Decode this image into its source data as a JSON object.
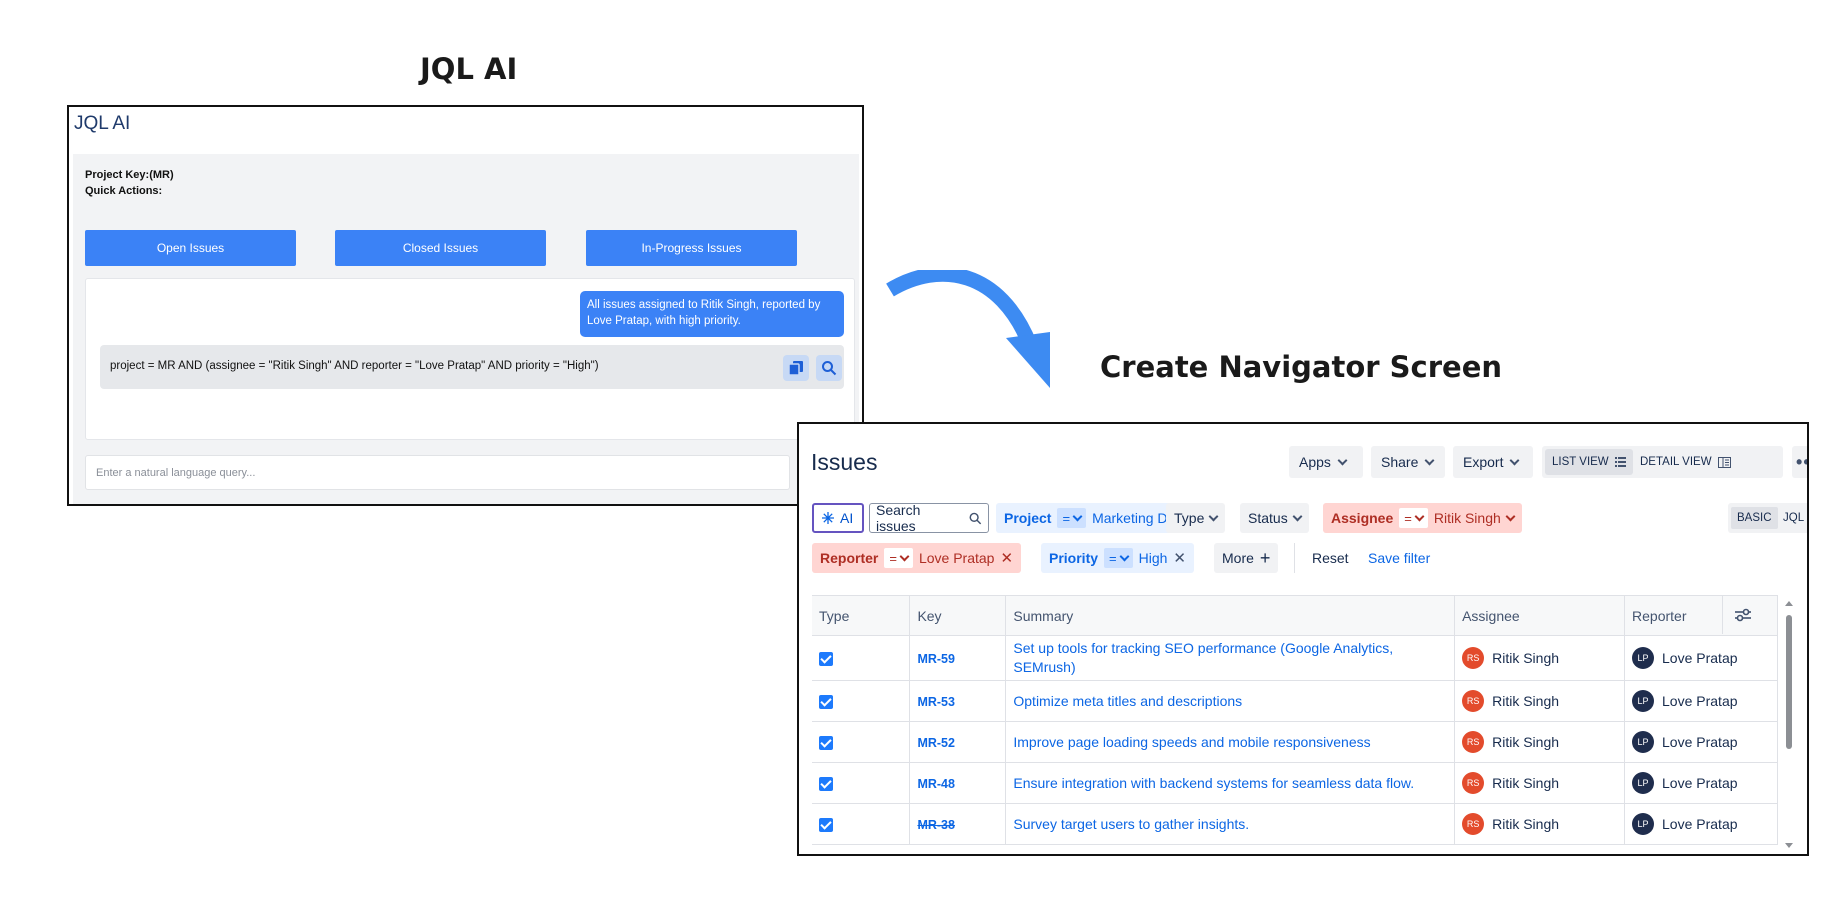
{
  "headings": {
    "left": "JQL AI",
    "right": "Create Navigator Screen"
  },
  "jql_ai": {
    "title": "JQL AI",
    "project_key": "Project Key:(MR)",
    "quick_actions": "Quick Actions:",
    "buttons": [
      "Open Issues",
      "Closed Issues",
      "In-Progress Issues"
    ],
    "user_message": "All issues assigned to Ritik Singh, reported by Love Pratap, with high priority.",
    "generated_query": "project = MR AND (assignee = \"Ritik Singh\" AND reporter = \"Love Pratap\" AND priority = \"High\")",
    "input_placeholder": "Enter a natural language query..."
  },
  "navigator": {
    "title": "Issues",
    "toolbar": {
      "apps": "Apps",
      "share": "Share",
      "export": "Export",
      "list_view": "LIST VIEW",
      "detail_view": "DETAIL VIEW",
      "more": "•••"
    },
    "filters": {
      "ai": "AI",
      "search_placeholder": "Search issues",
      "project_label": "Project",
      "project_op": "=",
      "project_value": "Marketing Dept",
      "type_label": "Type",
      "status_label": "Status",
      "assignee_label": "Assignee",
      "assignee_op": "=",
      "assignee_value": "Ritik Singh",
      "reporter_label": "Reporter",
      "reporter_op": "=",
      "reporter_value": "Love Pratap",
      "priority_label": "Priority",
      "priority_op": "=",
      "priority_value": "High",
      "more": "More",
      "reset": "Reset",
      "save_filter": "Save filter",
      "basic": "BASIC",
      "jql": "JQL"
    },
    "columns": [
      "Type",
      "Key",
      "Summary",
      "Assignee",
      "Reporter"
    ],
    "rows": [
      {
        "key": "MR-59",
        "summary": "Set up tools for tracking SEO performance (Google Analytics, SEMrush)",
        "assignee": "Ritik Singh",
        "assignee_initials": "RS",
        "reporter": "Love Pratap",
        "reporter_initials": "LP"
      },
      {
        "key": "MR-53",
        "summary": "Optimize meta titles and descriptions",
        "assignee": "Ritik Singh",
        "assignee_initials": "RS",
        "reporter": "Love Pratap",
        "reporter_initials": "LP"
      },
      {
        "key": "MR-52",
        "summary": "Improve page loading speeds and mobile responsiveness",
        "assignee": "Ritik Singh",
        "assignee_initials": "RS",
        "reporter": "Love Pratap",
        "reporter_initials": "LP"
      },
      {
        "key": "MR-48",
        "summary": "Ensure integration with backend systems for seamless data flow.",
        "assignee": "Ritik Singh",
        "assignee_initials": "RS",
        "reporter": "Love Pratap",
        "reporter_initials": "LP"
      },
      {
        "key": "MR-38",
        "summary": "Survey target users to gather insights.",
        "assignee": "Ritik Singh",
        "assignee_initials": "RS",
        "reporter": "Love Pratap",
        "reporter_initials": "LP"
      }
    ]
  },
  "colors": {
    "accent_blue": "#3b82f6",
    "jira_blue": "#0c66e4",
    "red_chip": "#ffd5d2",
    "blue_chip": "#e9f2ff",
    "arrow": "#3d8bf2"
  },
  "icons": [
    "copy-icon",
    "search-icon",
    "curved-arrow-icon",
    "ai-sparkle-icon",
    "chevron-down-icon",
    "list-icon",
    "detail-view-icon",
    "close-icon",
    "plus-icon",
    "column-settings-icon"
  ]
}
